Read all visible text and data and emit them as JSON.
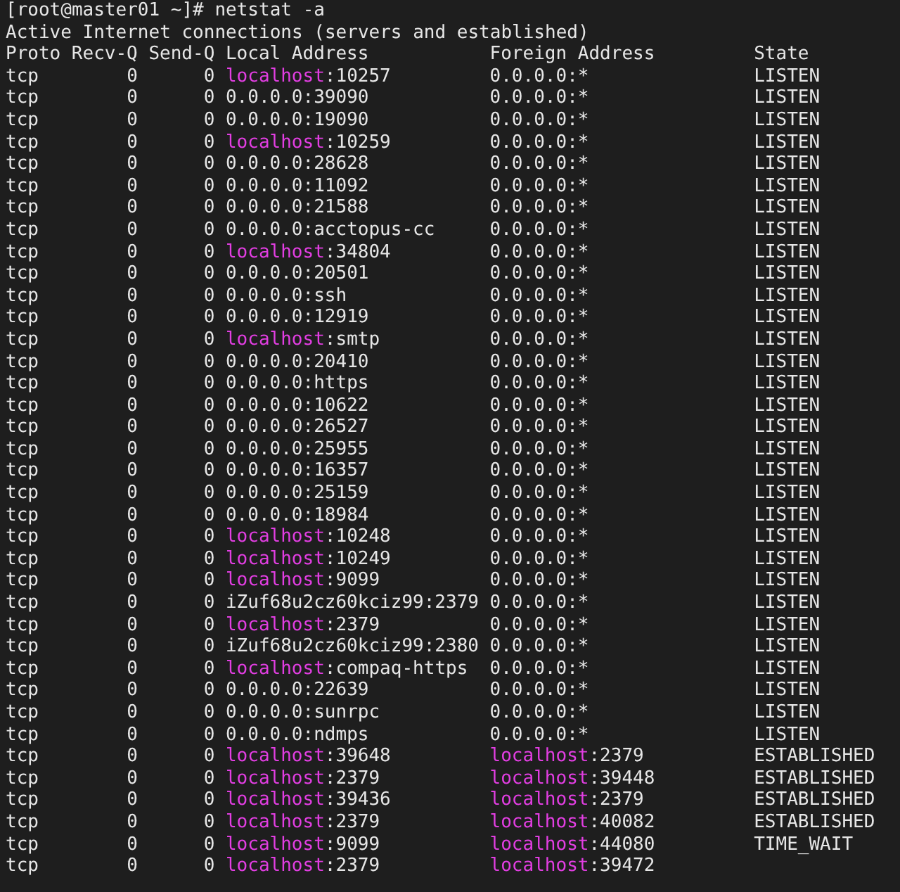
{
  "prompt": "[root@master01 ~]# netstat -a",
  "title": "Active Internet connections (servers and established)",
  "columns": [
    "Proto",
    "Recv-Q",
    "Send-Q",
    "Local Address",
    "Foreign Address",
    "State"
  ],
  "rows": [
    {
      "proto": "tcp",
      "recv_q": "0",
      "send_q": "0",
      "local": {
        "host": "localhost",
        "rest": ":10257",
        "colored": true
      },
      "foreign": {
        "host": "0.0.0.0",
        "rest": ":*",
        "colored": false
      },
      "state": "LISTEN"
    },
    {
      "proto": "tcp",
      "recv_q": "0",
      "send_q": "0",
      "local": {
        "host": "0.0.0.0",
        "rest": ":39090",
        "colored": false
      },
      "foreign": {
        "host": "0.0.0.0",
        "rest": ":*",
        "colored": false
      },
      "state": "LISTEN"
    },
    {
      "proto": "tcp",
      "recv_q": "0",
      "send_q": "0",
      "local": {
        "host": "0.0.0.0",
        "rest": ":19090",
        "colored": false
      },
      "foreign": {
        "host": "0.0.0.0",
        "rest": ":*",
        "colored": false
      },
      "state": "LISTEN"
    },
    {
      "proto": "tcp",
      "recv_q": "0",
      "send_q": "0",
      "local": {
        "host": "localhost",
        "rest": ":10259",
        "colored": true
      },
      "foreign": {
        "host": "0.0.0.0",
        "rest": ":*",
        "colored": false
      },
      "state": "LISTEN"
    },
    {
      "proto": "tcp",
      "recv_q": "0",
      "send_q": "0",
      "local": {
        "host": "0.0.0.0",
        "rest": ":28628",
        "colored": false
      },
      "foreign": {
        "host": "0.0.0.0",
        "rest": ":*",
        "colored": false
      },
      "state": "LISTEN"
    },
    {
      "proto": "tcp",
      "recv_q": "0",
      "send_q": "0",
      "local": {
        "host": "0.0.0.0",
        "rest": ":11092",
        "colored": false
      },
      "foreign": {
        "host": "0.0.0.0",
        "rest": ":*",
        "colored": false
      },
      "state": "LISTEN"
    },
    {
      "proto": "tcp",
      "recv_q": "0",
      "send_q": "0",
      "local": {
        "host": "0.0.0.0",
        "rest": ":21588",
        "colored": false
      },
      "foreign": {
        "host": "0.0.0.0",
        "rest": ":*",
        "colored": false
      },
      "state": "LISTEN"
    },
    {
      "proto": "tcp",
      "recv_q": "0",
      "send_q": "0",
      "local": {
        "host": "0.0.0.0",
        "rest": ":acctopus-cc",
        "colored": false
      },
      "foreign": {
        "host": "0.0.0.0",
        "rest": ":*",
        "colored": false
      },
      "state": "LISTEN"
    },
    {
      "proto": "tcp",
      "recv_q": "0",
      "send_q": "0",
      "local": {
        "host": "localhost",
        "rest": ":34804",
        "colored": true
      },
      "foreign": {
        "host": "0.0.0.0",
        "rest": ":*",
        "colored": false
      },
      "state": "LISTEN"
    },
    {
      "proto": "tcp",
      "recv_q": "0",
      "send_q": "0",
      "local": {
        "host": "0.0.0.0",
        "rest": ":20501",
        "colored": false
      },
      "foreign": {
        "host": "0.0.0.0",
        "rest": ":*",
        "colored": false
      },
      "state": "LISTEN"
    },
    {
      "proto": "tcp",
      "recv_q": "0",
      "send_q": "0",
      "local": {
        "host": "0.0.0.0",
        "rest": ":ssh",
        "colored": false
      },
      "foreign": {
        "host": "0.0.0.0",
        "rest": ":*",
        "colored": false
      },
      "state": "LISTEN"
    },
    {
      "proto": "tcp",
      "recv_q": "0",
      "send_q": "0",
      "local": {
        "host": "0.0.0.0",
        "rest": ":12919",
        "colored": false
      },
      "foreign": {
        "host": "0.0.0.0",
        "rest": ":*",
        "colored": false
      },
      "state": "LISTEN"
    },
    {
      "proto": "tcp",
      "recv_q": "0",
      "send_q": "0",
      "local": {
        "host": "localhost",
        "rest": ":smtp",
        "colored": true
      },
      "foreign": {
        "host": "0.0.0.0",
        "rest": ":*",
        "colored": false
      },
      "state": "LISTEN"
    },
    {
      "proto": "tcp",
      "recv_q": "0",
      "send_q": "0",
      "local": {
        "host": "0.0.0.0",
        "rest": ":20410",
        "colored": false
      },
      "foreign": {
        "host": "0.0.0.0",
        "rest": ":*",
        "colored": false
      },
      "state": "LISTEN"
    },
    {
      "proto": "tcp",
      "recv_q": "0",
      "send_q": "0",
      "local": {
        "host": "0.0.0.0",
        "rest": ":https",
        "colored": false
      },
      "foreign": {
        "host": "0.0.0.0",
        "rest": ":*",
        "colored": false
      },
      "state": "LISTEN"
    },
    {
      "proto": "tcp",
      "recv_q": "0",
      "send_q": "0",
      "local": {
        "host": "0.0.0.0",
        "rest": ":10622",
        "colored": false
      },
      "foreign": {
        "host": "0.0.0.0",
        "rest": ":*",
        "colored": false
      },
      "state": "LISTEN"
    },
    {
      "proto": "tcp",
      "recv_q": "0",
      "send_q": "0",
      "local": {
        "host": "0.0.0.0",
        "rest": ":26527",
        "colored": false
      },
      "foreign": {
        "host": "0.0.0.0",
        "rest": ":*",
        "colored": false
      },
      "state": "LISTEN"
    },
    {
      "proto": "tcp",
      "recv_q": "0",
      "send_q": "0",
      "local": {
        "host": "0.0.0.0",
        "rest": ":25955",
        "colored": false
      },
      "foreign": {
        "host": "0.0.0.0",
        "rest": ":*",
        "colored": false
      },
      "state": "LISTEN"
    },
    {
      "proto": "tcp",
      "recv_q": "0",
      "send_q": "0",
      "local": {
        "host": "0.0.0.0",
        "rest": ":16357",
        "colored": false
      },
      "foreign": {
        "host": "0.0.0.0",
        "rest": ":*",
        "colored": false
      },
      "state": "LISTEN"
    },
    {
      "proto": "tcp",
      "recv_q": "0",
      "send_q": "0",
      "local": {
        "host": "0.0.0.0",
        "rest": ":25159",
        "colored": false
      },
      "foreign": {
        "host": "0.0.0.0",
        "rest": ":*",
        "colored": false
      },
      "state": "LISTEN"
    },
    {
      "proto": "tcp",
      "recv_q": "0",
      "send_q": "0",
      "local": {
        "host": "0.0.0.0",
        "rest": ":18984",
        "colored": false
      },
      "foreign": {
        "host": "0.0.0.0",
        "rest": ":*",
        "colored": false
      },
      "state": "LISTEN"
    },
    {
      "proto": "tcp",
      "recv_q": "0",
      "send_q": "0",
      "local": {
        "host": "localhost",
        "rest": ":10248",
        "colored": true
      },
      "foreign": {
        "host": "0.0.0.0",
        "rest": ":*",
        "colored": false
      },
      "state": "LISTEN"
    },
    {
      "proto": "tcp",
      "recv_q": "0",
      "send_q": "0",
      "local": {
        "host": "localhost",
        "rest": ":10249",
        "colored": true
      },
      "foreign": {
        "host": "0.0.0.0",
        "rest": ":*",
        "colored": false
      },
      "state": "LISTEN"
    },
    {
      "proto": "tcp",
      "recv_q": "0",
      "send_q": "0",
      "local": {
        "host": "localhost",
        "rest": ":9099",
        "colored": true
      },
      "foreign": {
        "host": "0.0.0.0",
        "rest": ":*",
        "colored": false
      },
      "state": "LISTEN"
    },
    {
      "proto": "tcp",
      "recv_q": "0",
      "send_q": "0",
      "local": {
        "host": "iZuf68u2cz60kciz99",
        "rest": ":2379",
        "colored": false
      },
      "foreign": {
        "host": "0.0.0.0",
        "rest": ":*",
        "colored": false
      },
      "state": "LISTEN"
    },
    {
      "proto": "tcp",
      "recv_q": "0",
      "send_q": "0",
      "local": {
        "host": "localhost",
        "rest": ":2379",
        "colored": true
      },
      "foreign": {
        "host": "0.0.0.0",
        "rest": ":*",
        "colored": false
      },
      "state": "LISTEN"
    },
    {
      "proto": "tcp",
      "recv_q": "0",
      "send_q": "0",
      "local": {
        "host": "iZuf68u2cz60kciz99",
        "rest": ":2380",
        "colored": false
      },
      "foreign": {
        "host": "0.0.0.0",
        "rest": ":*",
        "colored": false
      },
      "state": "LISTEN"
    },
    {
      "proto": "tcp",
      "recv_q": "0",
      "send_q": "0",
      "local": {
        "host": "localhost",
        "rest": ":compaq-https",
        "colored": true
      },
      "foreign": {
        "host": "0.0.0.0",
        "rest": ":*",
        "colored": false
      },
      "state": "LISTEN"
    },
    {
      "proto": "tcp",
      "recv_q": "0",
      "send_q": "0",
      "local": {
        "host": "0.0.0.0",
        "rest": ":22639",
        "colored": false
      },
      "foreign": {
        "host": "0.0.0.0",
        "rest": ":*",
        "colored": false
      },
      "state": "LISTEN"
    },
    {
      "proto": "tcp",
      "recv_q": "0",
      "send_q": "0",
      "local": {
        "host": "0.0.0.0",
        "rest": ":sunrpc",
        "colored": false
      },
      "foreign": {
        "host": "0.0.0.0",
        "rest": ":*",
        "colored": false
      },
      "state": "LISTEN"
    },
    {
      "proto": "tcp",
      "recv_q": "0",
      "send_q": "0",
      "local": {
        "host": "0.0.0.0",
        "rest": ":ndmps",
        "colored": false
      },
      "foreign": {
        "host": "0.0.0.0",
        "rest": ":*",
        "colored": false
      },
      "state": "LISTEN"
    },
    {
      "proto": "tcp",
      "recv_q": "0",
      "send_q": "0",
      "local": {
        "host": "localhost",
        "rest": ":39648",
        "colored": true
      },
      "foreign": {
        "host": "localhost",
        "rest": ":2379",
        "colored": true
      },
      "state": "ESTABLISHED"
    },
    {
      "proto": "tcp",
      "recv_q": "0",
      "send_q": "0",
      "local": {
        "host": "localhost",
        "rest": ":2379",
        "colored": true
      },
      "foreign": {
        "host": "localhost",
        "rest": ":39448",
        "colored": true
      },
      "state": "ESTABLISHED"
    },
    {
      "proto": "tcp",
      "recv_q": "0",
      "send_q": "0",
      "local": {
        "host": "localhost",
        "rest": ":39436",
        "colored": true
      },
      "foreign": {
        "host": "localhost",
        "rest": ":2379",
        "colored": true
      },
      "state": "ESTABLISHED"
    },
    {
      "proto": "tcp",
      "recv_q": "0",
      "send_q": "0",
      "local": {
        "host": "localhost",
        "rest": ":2379",
        "colored": true
      },
      "foreign": {
        "host": "localhost",
        "rest": ":40082",
        "colored": true
      },
      "state": "ESTABLISHED"
    },
    {
      "proto": "tcp",
      "recv_q": "0",
      "send_q": "0",
      "local": {
        "host": "localhost",
        "rest": ":9099",
        "colored": true
      },
      "foreign": {
        "host": "localhost",
        "rest": ":44080",
        "colored": true
      },
      "state": "TIME_WAIT"
    },
    {
      "proto": "tcp",
      "recv_q": "0",
      "send_q": "0",
      "local": {
        "host": "localhost",
        "rest": ":2379",
        "colored": true
      },
      "foreign": {
        "host": "localhost",
        "rest": ":39472",
        "colored": true
      }
    }
  ]
}
